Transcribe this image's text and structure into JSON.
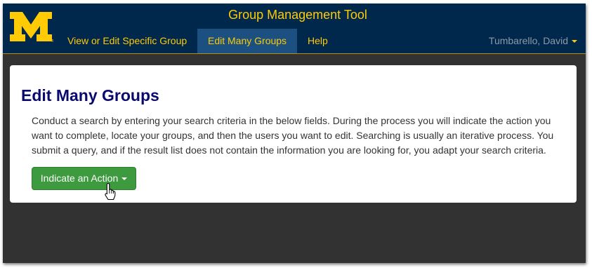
{
  "app": {
    "title": "Group Management Tool",
    "logo_letter": "M",
    "brand_colors": {
      "navy": "#00274c",
      "maize": "#ffcb05"
    }
  },
  "nav": {
    "items": [
      {
        "label": "View or Edit Specific Group",
        "active": false
      },
      {
        "label": "Edit Many Groups",
        "active": true
      },
      {
        "label": "Help",
        "active": false
      }
    ],
    "user_name": "Tumbarello, David"
  },
  "main": {
    "title": "Edit Many Groups",
    "description": "Conduct a search by entering your search criteria in the below fields. During the process you will indicate the action you want to complete, locate your groups, and then the users you want to edit. Searching is usually an iterative process. You submit a query, and if the result list does not contain the information you are looking for, you adapt your search criteria.",
    "action_button_label": "Indicate an Action"
  },
  "icons": {
    "logo": "university-block-m-logo",
    "dropdown": "caret-down-icon",
    "cursor": "hand-pointer-cursor-icon"
  }
}
